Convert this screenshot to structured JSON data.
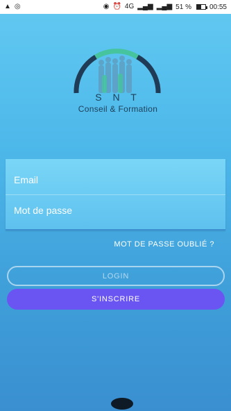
{
  "status_bar": {
    "network_label": "4G",
    "battery_percent": "51 %",
    "battery_level": 0.51,
    "time": "00:55",
    "icons": [
      "warning-icon",
      "target-icon",
      "nfc-icon",
      "alarm-icon",
      "vibrate-icon",
      "signal-icon",
      "signal-icon",
      "battery-icon"
    ]
  },
  "logo": {
    "title": "S N T",
    "subtitle": "Conseil & Formation",
    "colors": {
      "arc_dark": "#1f3b55",
      "arc_green": "#46c49d",
      "people": "#5f9fc3"
    }
  },
  "form": {
    "email_placeholder": "Email",
    "password_placeholder": "Mot de passe"
  },
  "actions": {
    "forgot_password": "MOT DE PASSE OUBLIÉ ?",
    "login": "LOGIN",
    "register": "S'INSCRIRE"
  },
  "colors": {
    "background_top": "#62c9f1",
    "background_bottom": "#3a8fd0",
    "register_button": "#6a55f2"
  }
}
